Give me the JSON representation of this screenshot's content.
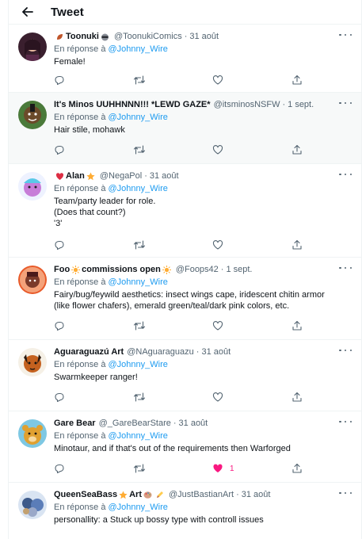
{
  "header": {
    "title": "Tweet"
  },
  "reply_prefix": "En réponse à",
  "reply_to": "@Johnny_Wire",
  "separator": "·",
  "tweets": [
    {
      "name": "Toonuki",
      "handle": "@ToonukiComics",
      "date": "31 août",
      "lines": [
        "Female!"
      ]
    },
    {
      "name": "It's Minos UUHHNNN!!! *LEWD GAZE*",
      "handle": "@itsminosNSFW",
      "date": "1 sept.",
      "lines": [
        "Hair stile, mohawk"
      ]
    },
    {
      "name": "Alan",
      "handle": "@NegaPol",
      "date": "31 août",
      "lines": [
        "Team/party leader for role.",
        "(Does that count?)",
        "'3'"
      ]
    },
    {
      "name_before": "Foo",
      "name_mid": "commissions open",
      "handle": "@Foops42",
      "date": "1 sept.",
      "lines": [
        "Fairy/bug/feywild aesthetics: insect wings cape, iridescent chitin armor",
        "(like flower chafers), emerald green/teal/dark pink colors, etc."
      ]
    },
    {
      "name": "Aguaraguazú Art",
      "handle": "@NAguaraguazu",
      "date": "31 août",
      "lines": [
        "Swarmkeeper ranger!"
      ]
    },
    {
      "name": "Gare Bear",
      "handle": "@_GareBearStare",
      "date": "31 août",
      "lines": [
        "Minotaur, and if that's out of the requirements then Warforged"
      ],
      "likes": "1"
    },
    {
      "name_before": "QueenSeaBass",
      "name_mid": "Art",
      "handle": "@JustBastianArt",
      "date": "31 août",
      "lines": [
        "personallity: a Stuck up bossy type with controll issues"
      ]
    }
  ],
  "colors": {
    "link": "#1d9bf0",
    "secondary": "#536471",
    "like": "#f91880",
    "text": "#0f1419"
  },
  "icons": [
    "back-arrow-icon",
    "more-icon",
    "reply-icon",
    "retweet-icon",
    "like-icon",
    "share-icon"
  ]
}
